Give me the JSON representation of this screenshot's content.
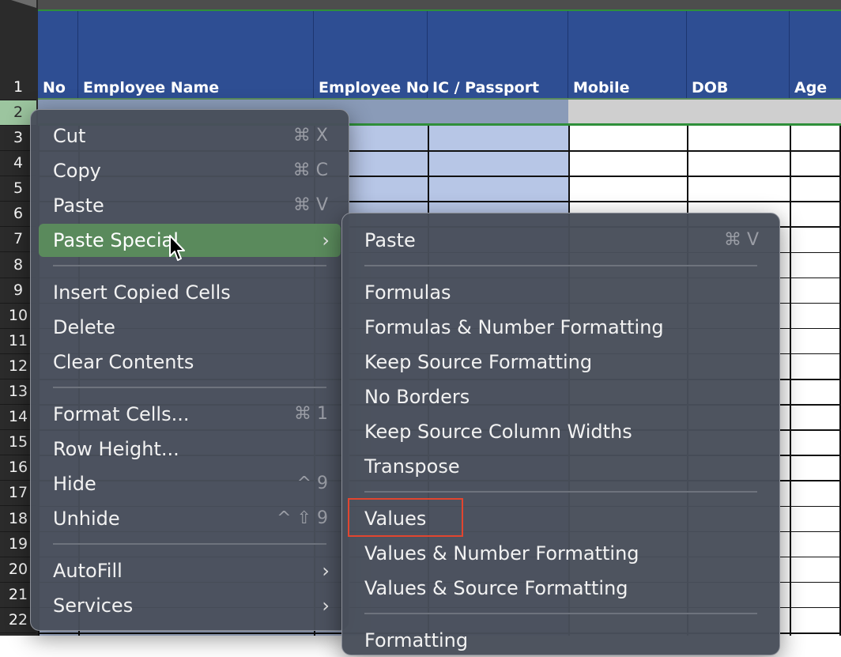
{
  "spreadsheet": {
    "headers": [
      {
        "id": "no",
        "label": "No"
      },
      {
        "id": "employee-name",
        "label": "Employee Name"
      },
      {
        "id": "employee-no",
        "label": "Employee No"
      },
      {
        "id": "ic-passport",
        "label": "IC / Passport"
      },
      {
        "id": "mobile",
        "label": "Mobile"
      },
      {
        "id": "dob",
        "label": "DOB"
      },
      {
        "id": "age",
        "label": "Age"
      }
    ],
    "row_numbers": [
      "1",
      "2",
      "3",
      "4",
      "5",
      "6",
      "7",
      "8",
      "9",
      "10",
      "11",
      "12",
      "13",
      "14",
      "15",
      "16",
      "17",
      "18",
      "19",
      "20",
      "21",
      "22"
    ],
    "selected_row": "2"
  },
  "context_menu": {
    "items": [
      {
        "label": "Cut",
        "shortcut": "⌘ X"
      },
      {
        "label": "Copy",
        "shortcut": "⌘ C"
      },
      {
        "label": "Paste",
        "shortcut": "⌘ V"
      },
      {
        "label": "Paste Special",
        "submenu_arrow": "›",
        "highlighted": true
      },
      {
        "label": "Insert Copied Cells"
      },
      {
        "label": "Delete"
      },
      {
        "label": "Clear Contents"
      },
      {
        "label": "Format Cells...",
        "shortcut": "⌘ 1"
      },
      {
        "label": "Row Height..."
      },
      {
        "label": "Hide",
        "shortcut": "^ 9"
      },
      {
        "label": "Unhide",
        "shortcut": "^ ⇧ 9"
      },
      {
        "label": "AutoFill",
        "submenu_arrow": "›"
      },
      {
        "label": "Services",
        "submenu_arrow": "›"
      }
    ]
  },
  "paste_special_menu": {
    "items": [
      {
        "label": "Paste",
        "shortcut": "⌘ V"
      },
      {
        "label": "Formulas"
      },
      {
        "label": "Formulas & Number Formatting"
      },
      {
        "label": "Keep Source Formatting"
      },
      {
        "label": "No Borders"
      },
      {
        "label": "Keep Source Column Widths"
      },
      {
        "label": "Transpose"
      },
      {
        "label": "Values",
        "annotated": true
      },
      {
        "label": "Values & Number Formatting"
      },
      {
        "label": "Values & Source Formatting"
      },
      {
        "label": "Formatting"
      }
    ]
  },
  "colors": {
    "header_blue": "#2e4e93",
    "selection_green": "#5a8a5c",
    "annotation_red": "#e2452f"
  }
}
